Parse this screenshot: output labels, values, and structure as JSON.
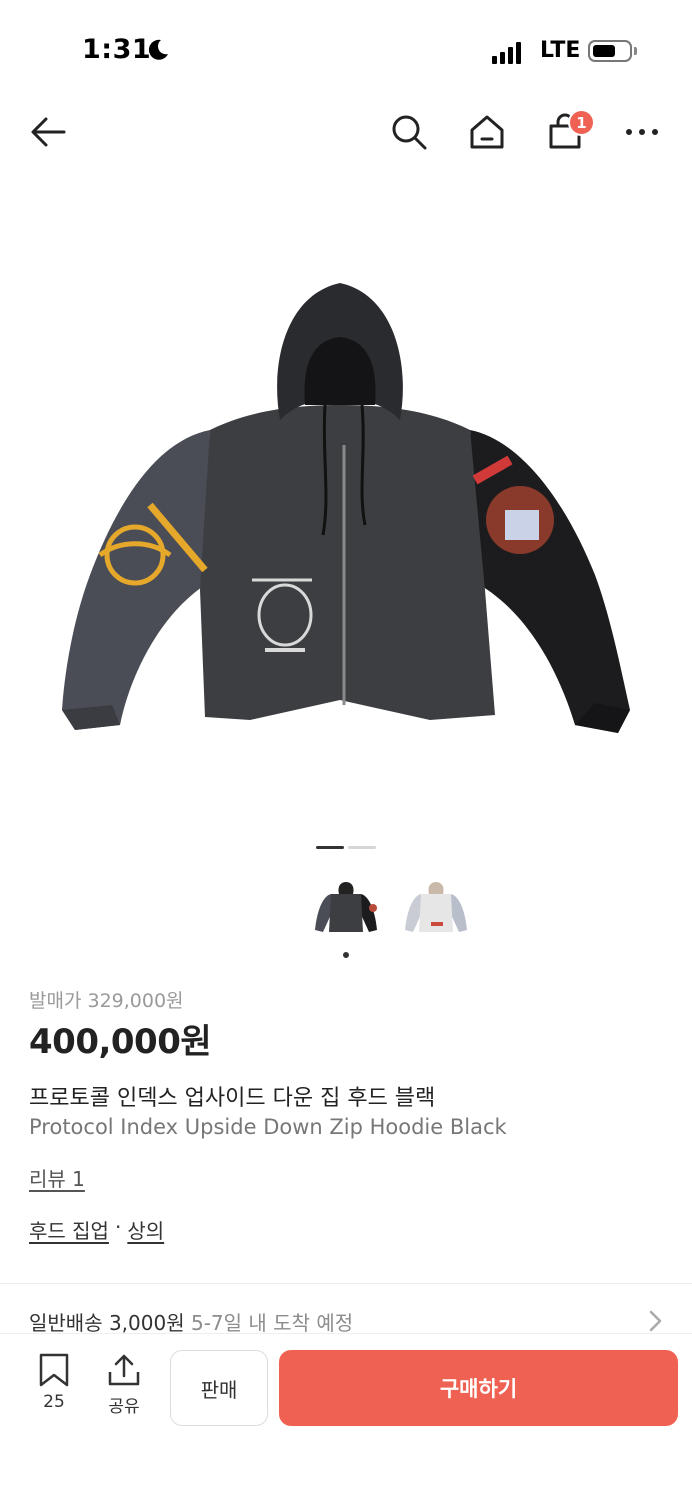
{
  "status_bar": {
    "time": "1:31",
    "network": "LTE"
  },
  "nav": {
    "cart_count": "1"
  },
  "product": {
    "release_price": "발매가 329,000원",
    "price": "400,000원",
    "name_ko": "프로토콜 인덱스 업사이드 다운 집 후드 블랙",
    "name_en": "Protocol Index Upside Down Zip Hoodie Black",
    "review": "리뷰 1",
    "categories": [
      "후드 집업",
      "상의"
    ],
    "category_separator": "·"
  },
  "shipping": {
    "label": "일반배송 3,000원",
    "eta": "5-7일 내 도착 예정"
  },
  "bottom_bar": {
    "bookmark_count": "25",
    "share_label": "공유",
    "sell_label": "판매",
    "buy_label": "구매하기"
  },
  "colors": {
    "accent": "#ef6253",
    "text": "#222222",
    "muted": "#9a9a9a"
  },
  "icons": [
    "back-arrow-icon",
    "search-icon",
    "home-icon",
    "shopping-bag-icon",
    "more-icon",
    "bookmark-icon",
    "share-icon",
    "chevron-right-icon",
    "moon-icon"
  ]
}
